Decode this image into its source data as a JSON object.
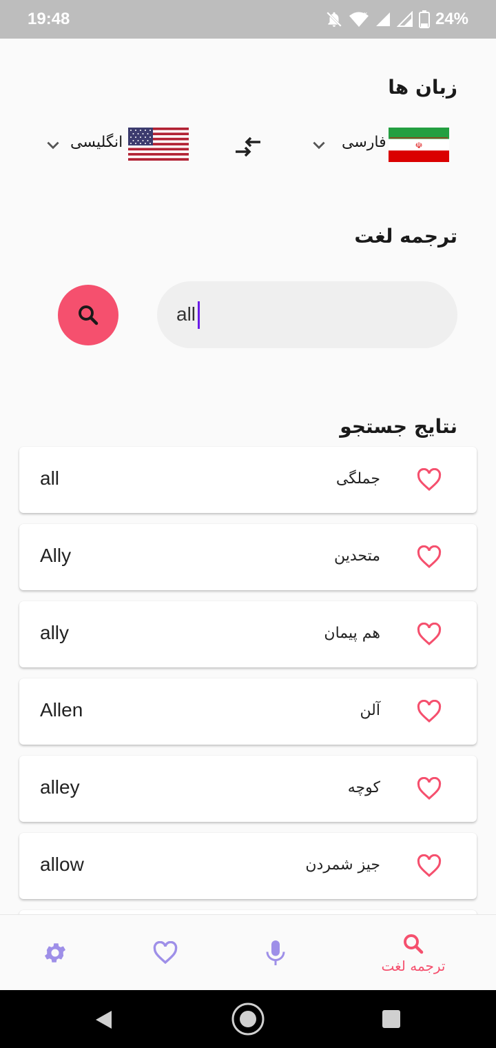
{
  "status_bar": {
    "time": "19:48",
    "battery": "24%"
  },
  "languages": {
    "title": "زبان ها",
    "source": {
      "label": "فارسی",
      "flag": "iran-flag"
    },
    "target": {
      "label": "انگلیسی",
      "flag": "usa-flag"
    }
  },
  "translate": {
    "title": "ترجمه لغت",
    "search_value": "all"
  },
  "results": {
    "title": "نتایج جستجو",
    "items": [
      {
        "word": "all",
        "translation": "جملگی"
      },
      {
        "word": "Ally",
        "translation": "متحدین"
      },
      {
        "word": "ally",
        "translation": "هم پیمان"
      },
      {
        "word": "Allen",
        "translation": "آلن"
      },
      {
        "word": "alley",
        "translation": "کوچه"
      },
      {
        "word": "allow",
        "translation": "جیز شمردن"
      }
    ]
  },
  "bottom_nav": {
    "active_label": "ترجمه لغت",
    "items": [
      "settings-icon",
      "heart-icon",
      "mic-icon",
      "search-icon"
    ]
  },
  "colors": {
    "accent": "#f5506e",
    "nav_inactive": "#9e8fe8",
    "caret": "#6a1be8"
  }
}
